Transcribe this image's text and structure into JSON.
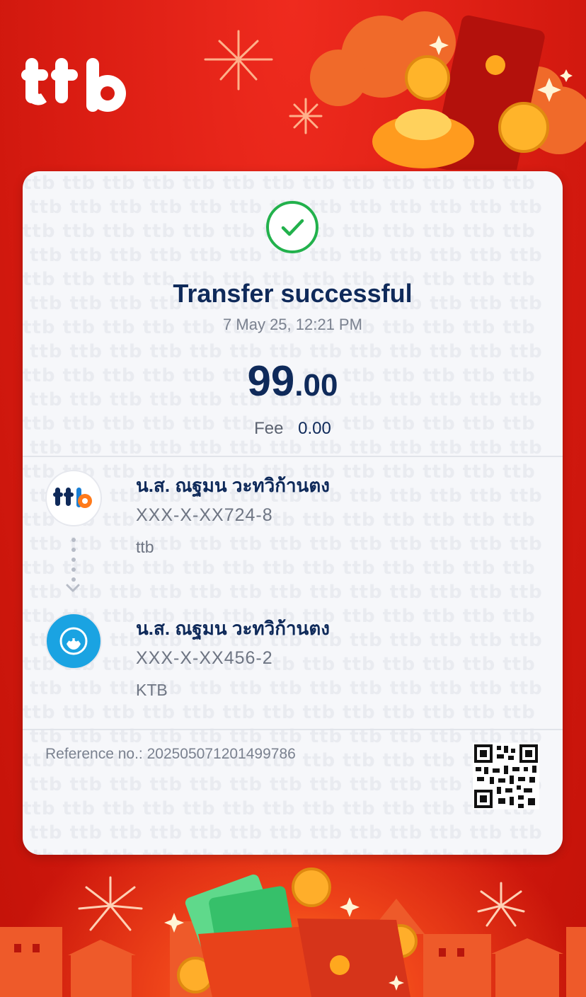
{
  "brand": {
    "logo_text": "ttb"
  },
  "receipt": {
    "title": "Transfer successful",
    "datetime": "7 May 25, 12:21 PM",
    "amount_int": "99",
    "amount_dec": ".00",
    "fee_label": "Fee",
    "fee_value": "0.00"
  },
  "from": {
    "name": "น.ส. ณฐมน วะทวิก้านตง",
    "account": "XXX-X-XX724-8",
    "bank": "ttb",
    "avatar_text": "ttb"
  },
  "to": {
    "name": "น.ส. ณฐมน วะทวิก้านตง",
    "account": "XXX-X-XX456-2",
    "bank": "KTB"
  },
  "reference": {
    "text": "Reference no.: 2025050712014997 86"
  },
  "colors": {
    "brand_red": "#d91c12",
    "navy": "#0f2a5a",
    "success_green": "#22b14c",
    "ktb_blue": "#1aa3e2"
  }
}
